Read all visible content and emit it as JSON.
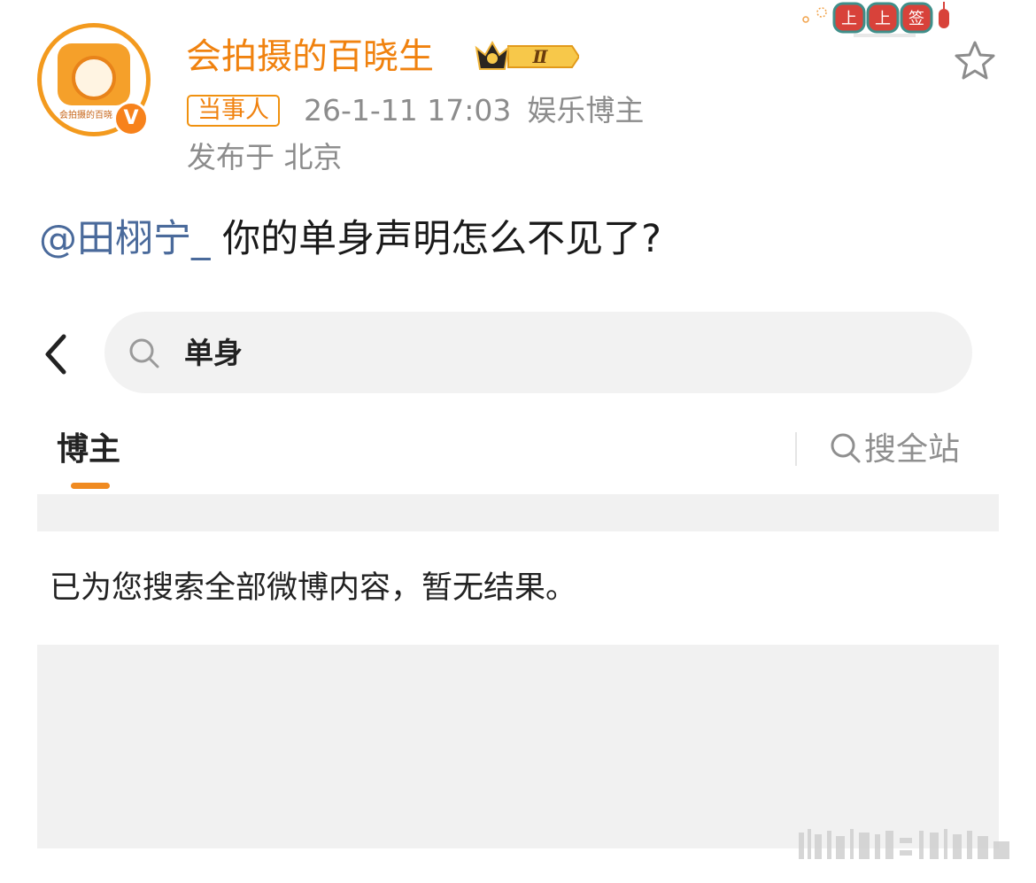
{
  "post": {
    "author": {
      "name": "会拍摄的百晓生",
      "avatar_text": "会拍摄的百晓",
      "verified_mark": "V",
      "level_badge": "Ⅱ"
    },
    "tag": "当事人",
    "time": "26-1-11 17:03",
    "category": "娱乐博主",
    "location": "发布于 北京",
    "mention": "@田栩宁_",
    "text": " 你的单身声明怎么不见了?",
    "icons": {
      "favorite": "star-outline-icon",
      "crown": "crown-icon",
      "decoration": "festival-sign-icon"
    }
  },
  "embedded_search": {
    "query": "单身",
    "tabs": [
      "博主"
    ],
    "active_tab": "博主",
    "search_all_label": "搜全站",
    "empty_message": "已为您搜索全部微博内容，暂无结果。",
    "accent_color": "#f08a20"
  },
  "colors": {
    "username": "#f0820f",
    "mention": "#4a6a9b",
    "meta": "#8c8c8c"
  }
}
